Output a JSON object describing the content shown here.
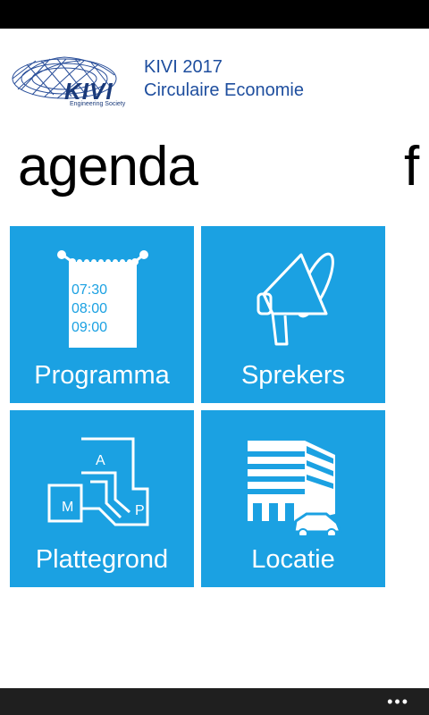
{
  "header": {
    "logo_text": "KIVI",
    "logo_sub": "Engineering Society",
    "title_line1": "KIVI 2017",
    "title_line2": "Circulaire Economie"
  },
  "pivot": {
    "current": "agenda",
    "next_peek": "f"
  },
  "tiles": [
    {
      "label": "Programma",
      "icon": "calendar-icon",
      "times": [
        "07:30",
        "08:00",
        "09:00"
      ]
    },
    {
      "label": "Sprekers",
      "icon": "megaphone-icon"
    },
    {
      "label": "Plattegrond",
      "icon": "floorplan-icon",
      "rooms": [
        "A",
        "M",
        "P"
      ]
    },
    {
      "label": "Locatie",
      "icon": "building-car-icon"
    }
  ],
  "app_bar": {
    "more": "•••"
  },
  "colors": {
    "tile": "#1ba1e2",
    "title": "#1e4e9e",
    "status_bar": "#000000",
    "app_bar": "#1f1f1f"
  }
}
